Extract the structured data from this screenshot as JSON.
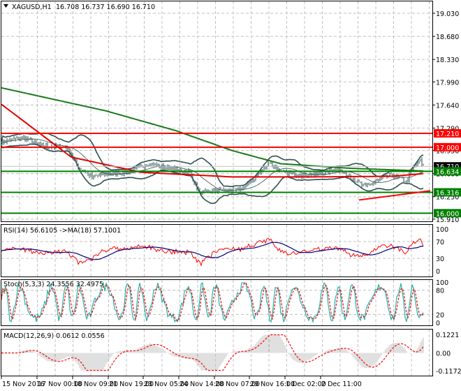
{
  "header": {
    "symbol": "XAGUSD,H1",
    "ohlc": "16.708 16.737 16.690 16.710"
  },
  "colors": {
    "price_bars": "#2f4f4f",
    "sma_fast": "#e00000",
    "sma_slow": "#1a7a1a",
    "bollinger": "#2f4f4f",
    "rsi": "#ff0000",
    "rsi_ma": "#000080",
    "stoch_main": "#20b2aa",
    "stoch_signal": "#ff0000",
    "macd_hist": "#c0c0c0",
    "macd_signal": "#ff0000",
    "resistance": "#ff0000",
    "support": "#008000",
    "current_price": "#000000"
  },
  "chart_data": [
    {
      "type": "line",
      "title": "XAGUSD,H1",
      "y_ticks": [
        "19.030",
        "18.680",
        "18.330",
        "17.990",
        "17.640",
        "17.290",
        "16.950",
        "16.600",
        "16.250",
        "15.910"
      ],
      "ylim": [
        15.88,
        19.18
      ],
      "x_labels": [
        "15 Nov 2016",
        "17 Nov 00:00",
        "18 Nov 09:00",
        "21 Nov 19:00",
        "23 Nov 05:00",
        "24 Nov 14:00",
        "28 Nov 07:00",
        "29 Nov 16:00",
        "1 Dec 02:00",
        "2 Dec 11:00"
      ],
      "price_keypoints": {
        "bar": [
          0,
          15,
          30,
          47,
          55,
          65,
          75,
          90,
          105,
          120,
          135,
          142,
          155,
          170,
          180,
          192,
          200,
          215,
          230,
          240,
          250,
          260,
          270,
          280,
          290,
          295,
          300,
          302
        ],
        "close": [
          17.08,
          17.15,
          17.02,
          17.0,
          16.7,
          16.55,
          16.6,
          16.62,
          16.75,
          16.68,
          16.62,
          16.3,
          16.35,
          16.35,
          16.5,
          16.78,
          16.62,
          16.58,
          16.6,
          16.68,
          16.55,
          16.4,
          16.5,
          16.58,
          16.48,
          16.7,
          16.8,
          16.71
        ]
      },
      "sma_fast": {
        "bar": [
          0,
          50,
          100,
          165,
          225,
          280,
          302
        ],
        "value": [
          17.65,
          16.85,
          16.62,
          16.55,
          16.55,
          16.56,
          16.6
        ]
      },
      "sma_slow": {
        "bar": [
          0,
          75,
          125,
          165,
          200,
          250,
          302
        ],
        "value": [
          17.9,
          17.55,
          17.25,
          16.95,
          16.75,
          16.68,
          16.64
        ]
      },
      "levels": [
        {
          "label": "17.210",
          "value": 17.21,
          "kind": "resistance"
        },
        {
          "label": "17.000",
          "value": 17.0,
          "kind": "resistance"
        },
        {
          "label": "16.710",
          "value": 16.71,
          "kind": "current"
        },
        {
          "label": "16.634",
          "value": 16.634,
          "kind": "support"
        },
        {
          "label": "16.316",
          "value": 16.316,
          "kind": "support"
        },
        {
          "label": "16.000",
          "value": 16.0,
          "kind": "support"
        }
      ],
      "trendline": {
        "from": {
          "bar": 256,
          "value": 16.2
        },
        "to": {
          "bar": 307,
          "value": 16.34
        }
      }
    },
    {
      "type": "line",
      "title": "RSI(14) 56.6105  ->MA(18) 57.1001",
      "y_ticks": [
        "100",
        "70",
        "30",
        "0"
      ],
      "ylim": [
        0,
        100
      ],
      "levels": [
        70,
        30
      ]
    },
    {
      "type": "line",
      "title": "Stoch(5,3,3) 24.3556 32.4975",
      "y_ticks": [
        "100",
        "80",
        "20",
        "0"
      ],
      "ylim": [
        0,
        100
      ],
      "levels": [
        80,
        20
      ]
    },
    {
      "type": "bar",
      "title": "MACD(12,26,9) 0.0612 0.0556",
      "y_ticks": [
        "0.1221",
        "0.00",
        "-0.1172"
      ],
      "ylim": [
        -0.1172,
        0.1221
      ]
    }
  ]
}
